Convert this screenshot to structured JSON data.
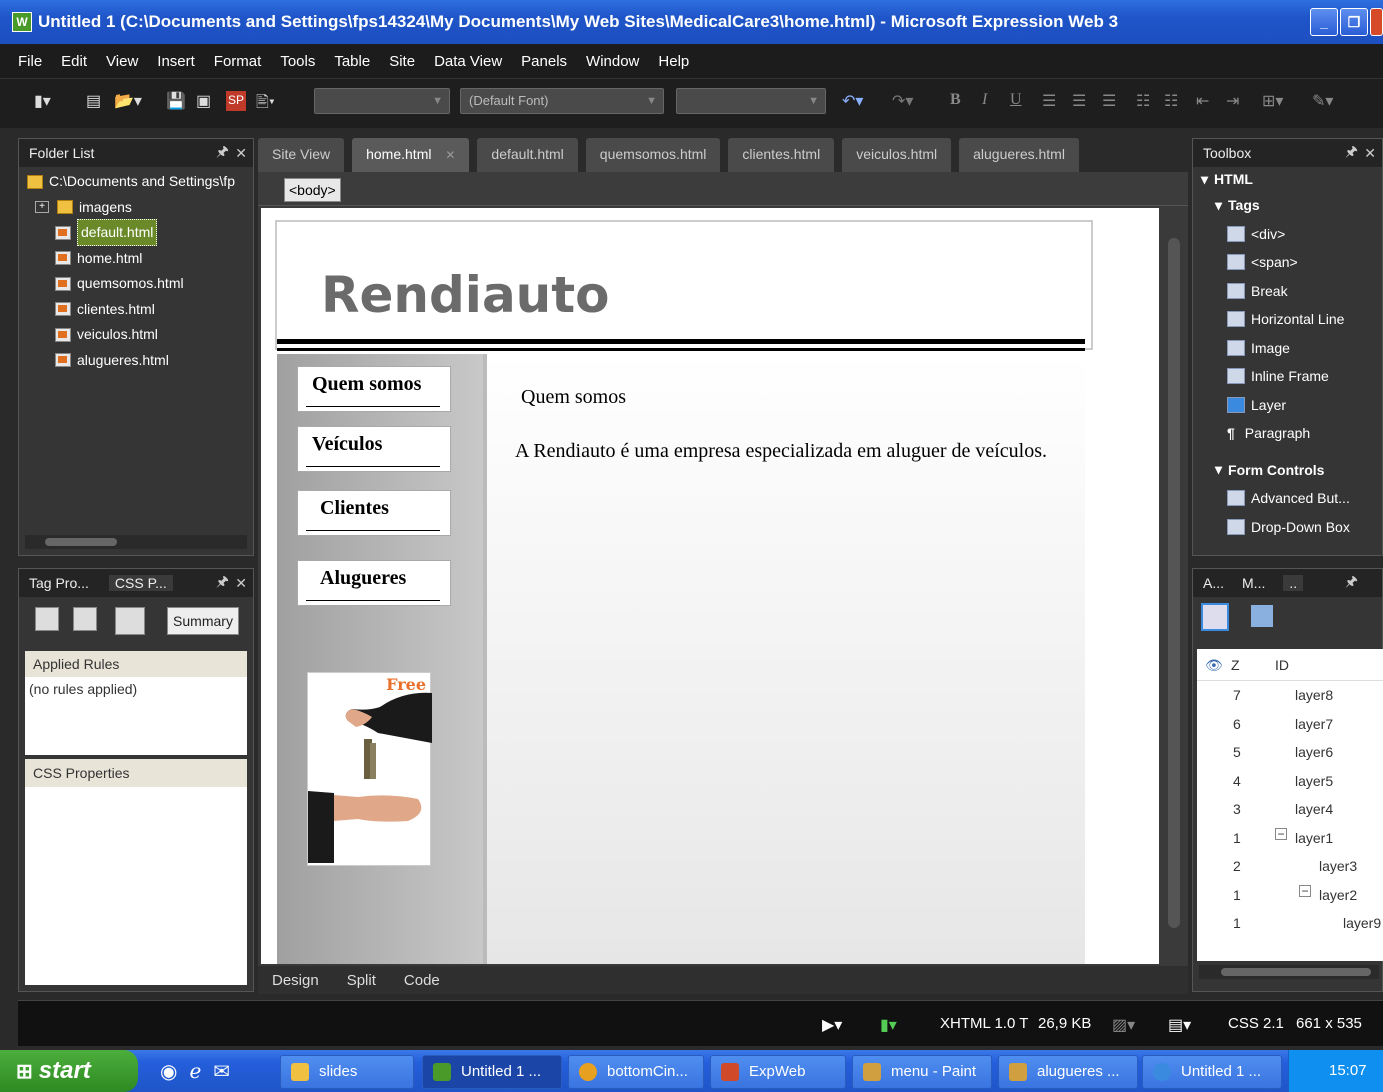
{
  "window": {
    "title": "Untitled 1 (C:\\Documents and Settings\\fps14324\\My Documents\\My Web Sites\\MedicalCare3\\home.html) - Microsoft Expression Web 3"
  },
  "menu": [
    "File",
    "Edit",
    "View",
    "Insert",
    "Format",
    "Tools",
    "Table",
    "Site",
    "Data View",
    "Panels",
    "Window",
    "Help"
  ],
  "toolbar": {
    "font_combo": "(Default Font)"
  },
  "folder_list": {
    "title": "Folder List",
    "root": "C:\\Documents and Settings\\fp",
    "items": [
      "imagens",
      "default.html",
      "home.html",
      "quemsomos.html",
      "clientes.html",
      "veiculos.html",
      "alugueres.html"
    ]
  },
  "tag_panel": {
    "tabs": [
      "Tag Pro...",
      "CSS P..."
    ],
    "summary_button": "Summary",
    "applied_rules": "Applied Rules",
    "no_rules": "(no rules applied)",
    "css_properties": "CSS Properties"
  },
  "doc_tabs": [
    "Site View",
    "home.html",
    "default.html",
    "quemsomos.html",
    "clientes.html",
    "veiculos.html",
    "alugueres.html"
  ],
  "quick_tag": "<body>",
  "site": {
    "title": "Rendiauto",
    "nav": [
      "Quem somos",
      "Veículos",
      "Clientes",
      "Alugueres"
    ],
    "main_heading": "Quem somos",
    "main_text": "A Rendiauto é uma empresa especializada em aluguer de veículos.",
    "free_label": "Free"
  },
  "view_tabs": [
    "Design",
    "Split",
    "Code"
  ],
  "toolbox": {
    "title": "Toolbox",
    "html": "HTML",
    "tags": "Tags",
    "tag_items": [
      "<div>",
      "<span>",
      "Break",
      "Horizontal Line",
      "Image",
      "Inline Frame",
      "Layer",
      "Paragraph"
    ],
    "form_controls": "Form Controls",
    "form_items": [
      "Advanced But...",
      "Drop-Down Box"
    ]
  },
  "layers_panel": {
    "tabs": [
      "A...",
      "M...",
      ".."
    ],
    "col_z": "Z",
    "col_id": "ID",
    "rows": [
      {
        "z": "7",
        "id": "layer8"
      },
      {
        "z": "6",
        "id": "layer7"
      },
      {
        "z": "5",
        "id": "layer6"
      },
      {
        "z": "4",
        "id": "layer5"
      },
      {
        "z": "3",
        "id": "layer4"
      },
      {
        "z": "1",
        "id": "layer1"
      },
      {
        "z": "2",
        "id": "layer3"
      },
      {
        "z": "1",
        "id": "layer2"
      },
      {
        "z": "1",
        "id": "layer9"
      }
    ]
  },
  "statusbar": {
    "doctype": "XHTML 1.0 T",
    "size": "26,9 KB",
    "css": "CSS 2.1",
    "dims": "661 x 535"
  },
  "taskbar": {
    "start": "start",
    "tasks": [
      "slides",
      "Untitled 1 ...",
      "bottomCin...",
      "ExpWeb",
      "menu - Paint",
      "alugueres ...",
      "Untitled 1 ..."
    ],
    "clock": "15:07"
  }
}
